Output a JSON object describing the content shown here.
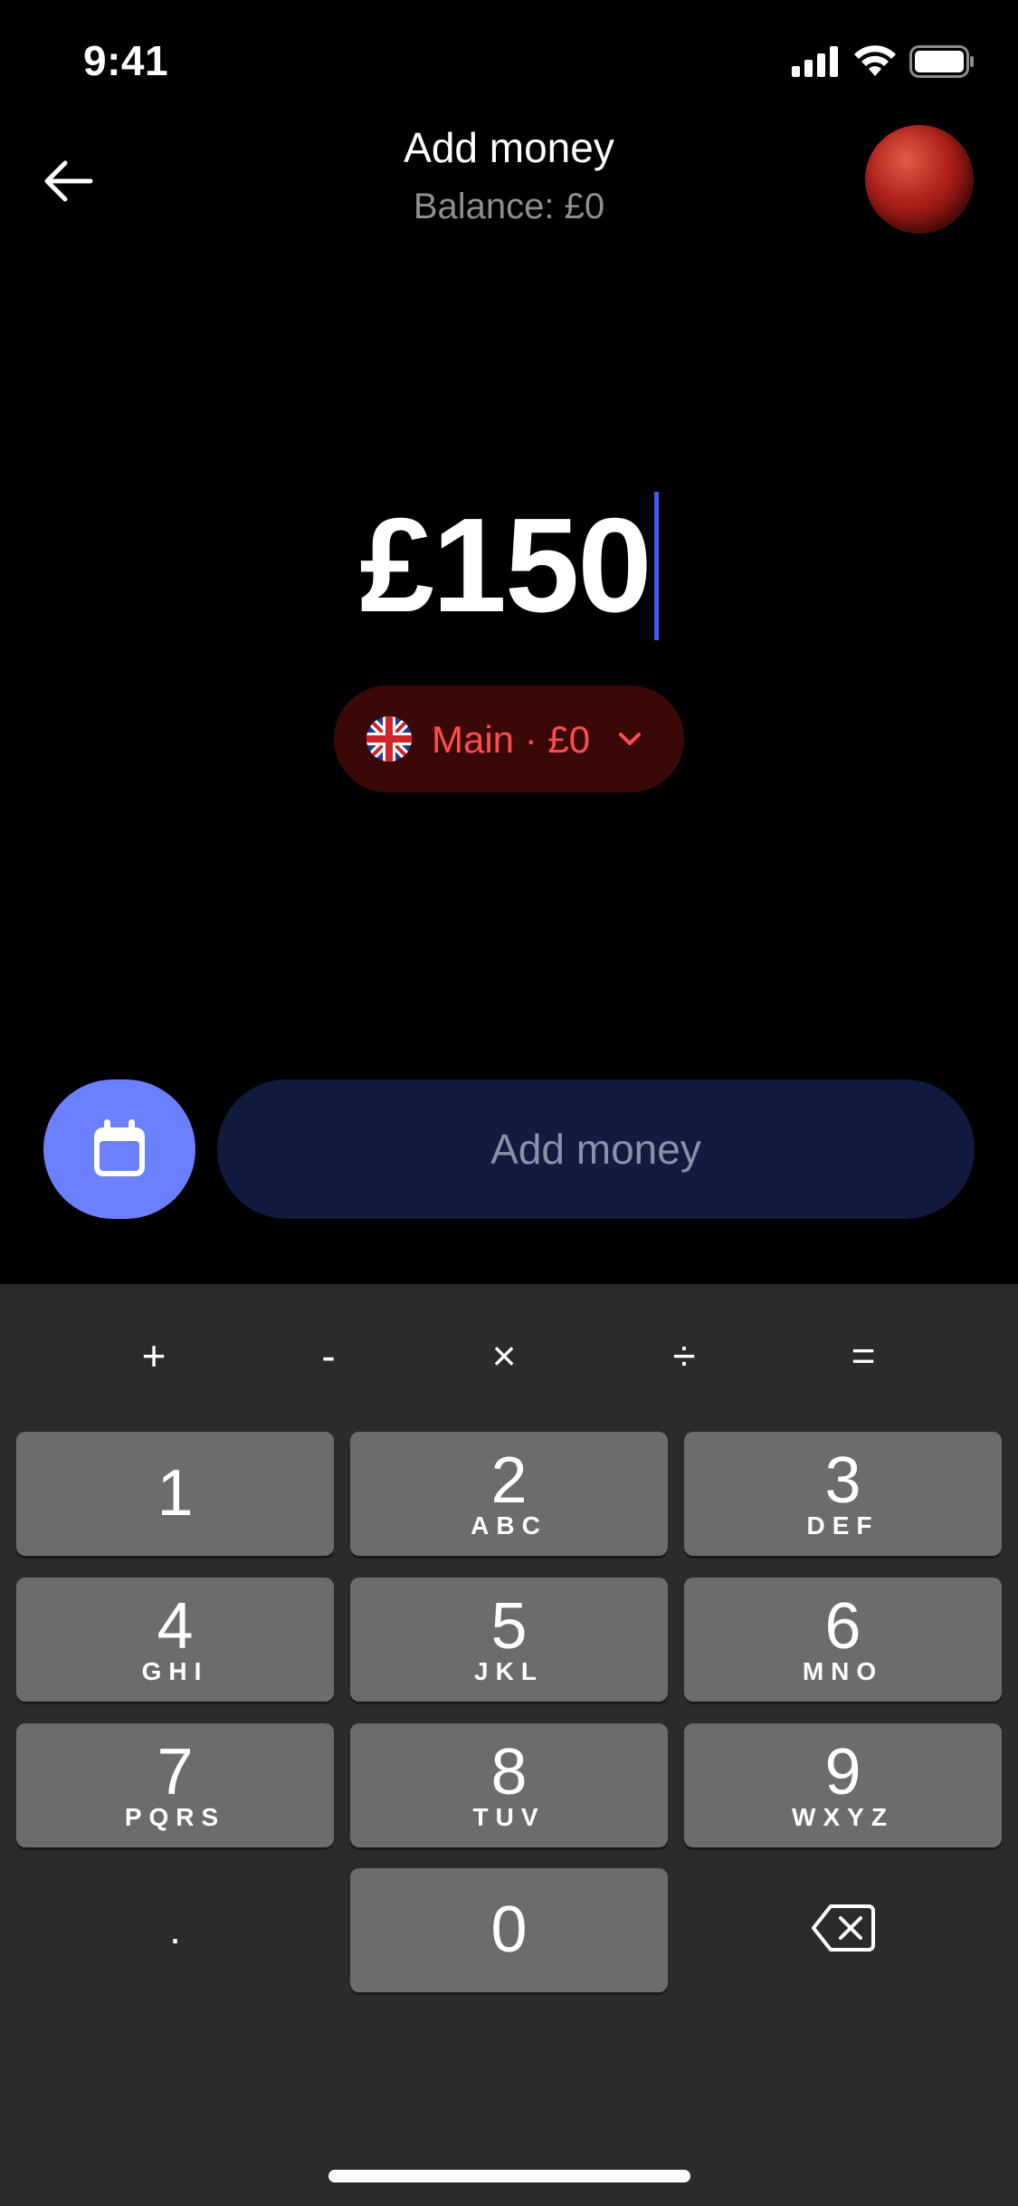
{
  "status_bar": {
    "time": "9:41",
    "icons": [
      "signal-icon",
      "wifi-icon",
      "battery-icon"
    ]
  },
  "header": {
    "title": "Add money",
    "subtitle": "Balance: £0",
    "back_icon": "arrow-left-icon",
    "avatar": "profile-avatar"
  },
  "amount": {
    "value": "£150"
  },
  "account": {
    "label": "Main · £0",
    "flag_icon": "uk-flag-icon",
    "chevron_icon": "chevron-down-icon",
    "color": "#ff4d4d"
  },
  "actions": {
    "schedule_icon": "calendar-icon",
    "add_money_label": "Add money"
  },
  "keyboard": {
    "operators": [
      "+",
      "-",
      "×",
      "÷",
      "="
    ],
    "keys": [
      {
        "num": "1",
        "letters": ""
      },
      {
        "num": "2",
        "letters": "ABC"
      },
      {
        "num": "3",
        "letters": "DEF"
      },
      {
        "num": "4",
        "letters": "GHI"
      },
      {
        "num": "5",
        "letters": "JKL"
      },
      {
        "num": "6",
        "letters": "MNO"
      },
      {
        "num": "7",
        "letters": "PQRS"
      },
      {
        "num": "8",
        "letters": "TUV"
      },
      {
        "num": "9",
        "letters": "WXYZ"
      },
      {
        "num": "0",
        "letters": ""
      }
    ],
    "decimal": ".",
    "delete_icon": "backspace-icon"
  },
  "colors": {
    "accent": "#6b80ff",
    "caret": "#3d5afe",
    "button_disabled_bg": "#111a3f"
  }
}
